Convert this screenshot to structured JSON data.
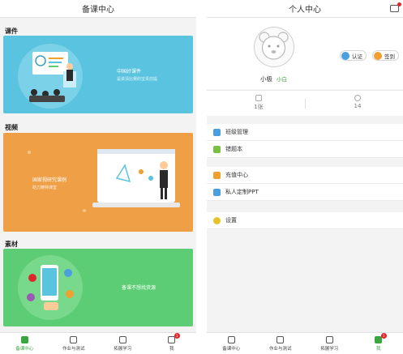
{
  "left": {
    "title": "备课中心",
    "sections": [
      {
        "label": "课件",
        "card_caption": "中国好课件",
        "card_subcaption": "是讲清比赛的宝贵前提",
        "card_color": "#5ac3df"
      },
      {
        "label": "视频",
        "card_caption": "国家视研究课例",
        "card_subcaption": "助力精特课堂",
        "card_color": "#efa046"
      },
      {
        "label": "素材",
        "card_caption": "备课不想找资源",
        "card_color": "#5ccd74"
      }
    ],
    "tabs": [
      {
        "label": "备课中心",
        "icon": "book-icon",
        "active": true
      },
      {
        "label": "作业与测试",
        "icon": "homework-icon",
        "active": false
      },
      {
        "label": "拓展学习",
        "icon": "learn-icon",
        "active": false
      },
      {
        "label": "我",
        "icon": "user-icon",
        "active": false,
        "badge": "1"
      }
    ]
  },
  "right": {
    "title": "个人中心",
    "username": "小极",
    "level": "小白",
    "buttons": {
      "certify": "认证",
      "checkin": "签到"
    },
    "stats": [
      {
        "value": "1张",
        "icon": "ticket-icon"
      },
      {
        "value": "14",
        "icon": "coin-icon"
      }
    ],
    "menu_groups": [
      [
        {
          "label": "班级管理",
          "icon": "class-icon",
          "color": "#4a9fe0"
        },
        {
          "label": "错题本",
          "icon": "notebook-icon",
          "color": "#7bc043"
        }
      ],
      [
        {
          "label": "充值中心",
          "icon": "recharge-icon",
          "color": "#f0a030"
        },
        {
          "label": "私人定制PPT",
          "icon": "ppt-icon",
          "color": "#4a9fe0"
        }
      ],
      [
        {
          "label": "设置",
          "icon": "settings-icon",
          "color": "#e6c32a"
        }
      ]
    ],
    "tabs": [
      {
        "label": "备课中心",
        "icon": "book-icon",
        "active": false
      },
      {
        "label": "作业与测试",
        "icon": "homework-icon",
        "active": false
      },
      {
        "label": "拓展学习",
        "icon": "learn-icon",
        "active": false
      },
      {
        "label": "我",
        "icon": "user-icon",
        "active": true,
        "badge": "1"
      }
    ]
  }
}
